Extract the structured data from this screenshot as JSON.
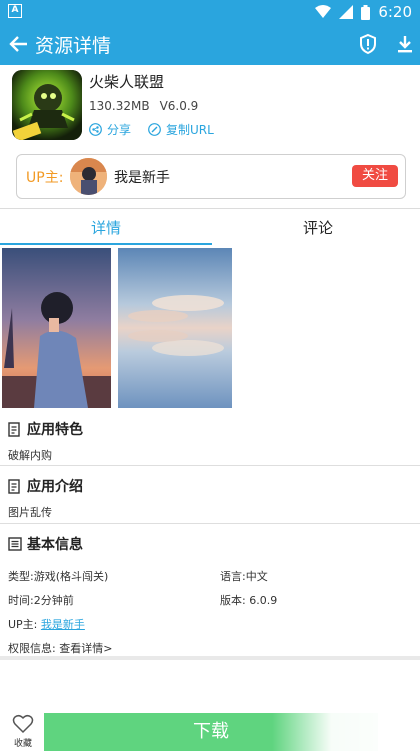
{
  "statusbar": {
    "time": "6:20"
  },
  "appbar": {
    "title": "资源详情"
  },
  "app": {
    "name": "火柴人联盟",
    "size": "130.32MB",
    "version": "V6.0.9",
    "share_label": "分享",
    "copy_url_label": "复制URL"
  },
  "uploader": {
    "label": "UP主:",
    "name": "我是新手",
    "follow_label": "关注"
  },
  "tabs": [
    {
      "label": "详情"
    },
    {
      "label": "评论"
    }
  ],
  "sections": {
    "features": {
      "title": "应用特色",
      "text": "破解内购"
    },
    "intro": {
      "title": "应用介绍",
      "text": "图片乱传"
    },
    "basic": {
      "title": "基本信息",
      "type": "类型:游戏(格斗闯关)",
      "language": "语言:中文",
      "time": "时间:2分钟前",
      "version": "版本: 6.0.9",
      "up_label": "UP主:",
      "up_name": "我是新手",
      "permissions": "权限信息: 查看详情>"
    }
  },
  "bottom": {
    "fav_label": "收藏",
    "download_label": "下载"
  },
  "colors": {
    "primary": "#2aa5de",
    "accent_orange": "#f29a25",
    "follow_red": "#f04b42",
    "download_green": "#5fd47f"
  }
}
